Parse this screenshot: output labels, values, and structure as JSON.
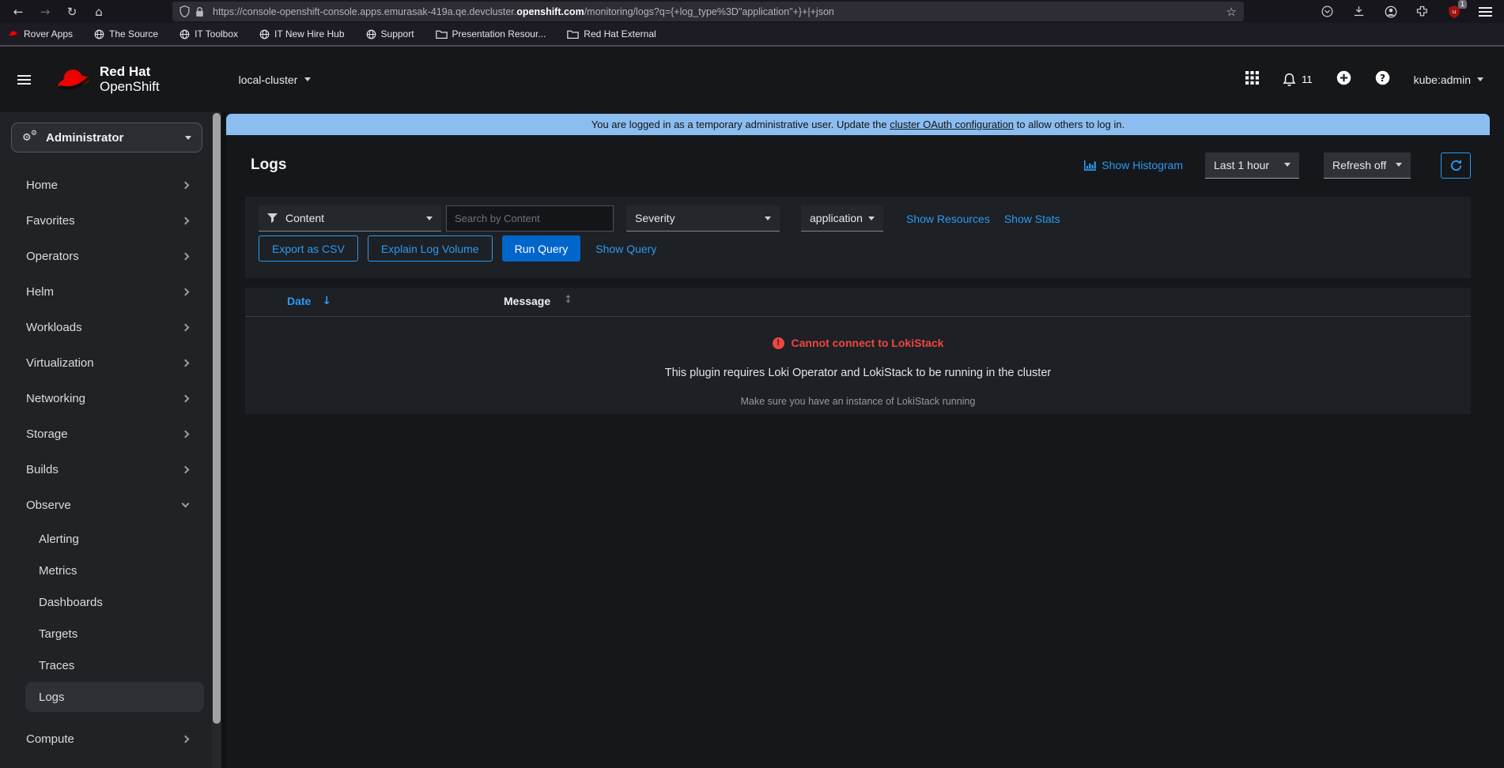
{
  "colors": {
    "accent": "#2b9af3",
    "primary": "#0066cc",
    "danger": "#ee4741",
    "banner": "#8bbdf0",
    "brand": "#ee0000"
  },
  "browser": {
    "url_prefix": "https://console-openshift-console.apps.emurasak-419a.qe.devcluster.",
    "url_host": "openshift.com",
    "url_path": "/monitoring/logs?q={+log_type%3D\"application\"+}+|+json",
    "bookmarks": [
      "Rover Apps",
      "The Source",
      "IT Toolbox",
      "IT New Hire Hub",
      "Support",
      "Presentation Resour...",
      "Red Hat External"
    ],
    "extension_badge": "1"
  },
  "masthead": {
    "brand_line1": "Red Hat",
    "brand_line2": "OpenShift",
    "cluster": "local-cluster",
    "notifications": "11",
    "user": "kube:admin"
  },
  "banner": {
    "prefix": "You are logged in as a temporary administrative user. Update the ",
    "link_text": "cluster OAuth configuration",
    "suffix": " to allow others to log in."
  },
  "sidebar": {
    "perspective": "Administrator",
    "items": [
      "Home",
      "Favorites",
      "Operators",
      "Helm",
      "Workloads",
      "Virtualization",
      "Networking",
      "Storage",
      "Builds"
    ],
    "observe": "Observe",
    "observe_children": [
      "Alerting",
      "Metrics",
      "Dashboards",
      "Targets",
      "Traces",
      "Logs"
    ],
    "selected": "Logs",
    "compute": "Compute"
  },
  "page": {
    "title": "Logs",
    "toolbar": {
      "show_histogram": "Show Histogram",
      "time_range": "Last 1 hour",
      "refresh_interval": "Refresh off"
    },
    "filters": {
      "attribute": "Content",
      "search_placeholder": "Search by Content",
      "severity": "Severity",
      "tenant": "application",
      "show_resources": "Show Resources",
      "show_stats": "Show Stats"
    },
    "actions": {
      "export_csv": "Export as CSV",
      "explain": "Explain Log Volume",
      "run_query": "Run Query",
      "show_query": "Show Query"
    },
    "table": {
      "columns": [
        "Date",
        "Message"
      ]
    },
    "error": {
      "title": "Cannot connect to LokiStack",
      "description": "This plugin requires Loki Operator and LokiStack to be running in the cluster",
      "hint": "Make sure you have an instance of LokiStack running"
    }
  }
}
